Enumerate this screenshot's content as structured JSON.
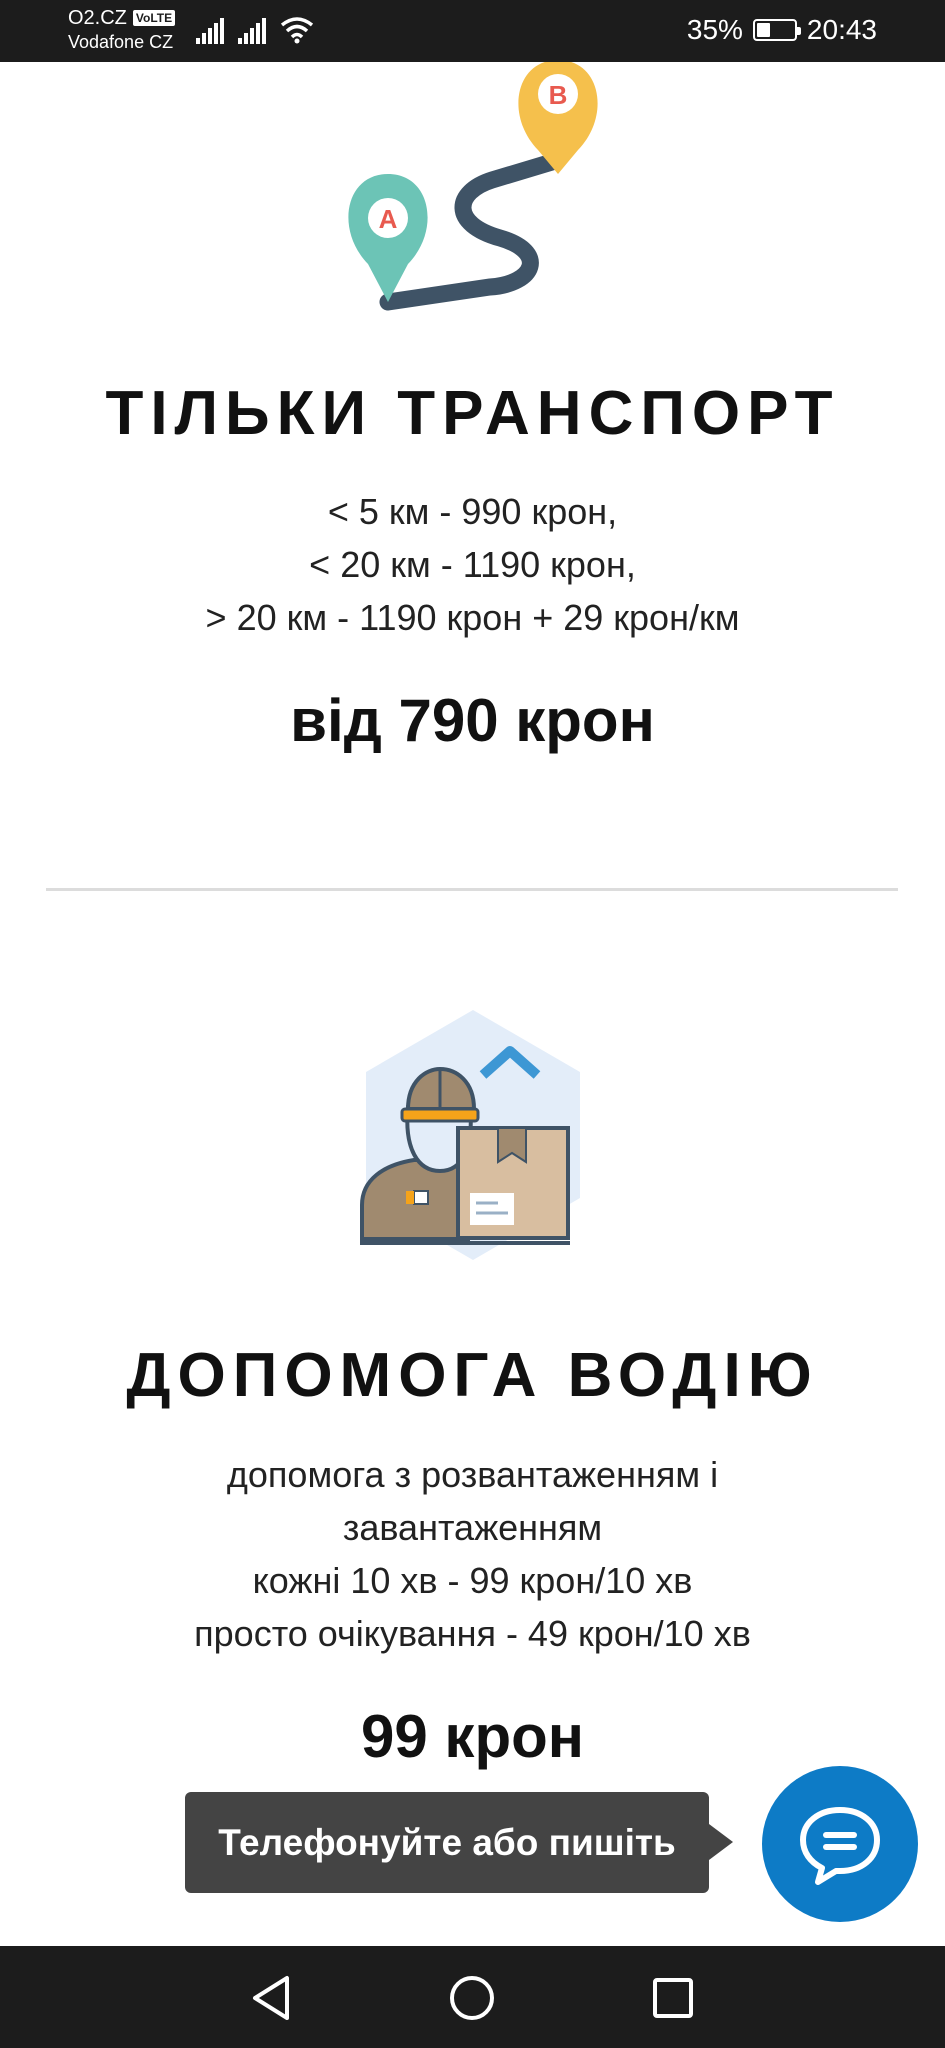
{
  "status_bar": {
    "carrier_primary": "O2.CZ",
    "volte_label": "VoLTE",
    "carrier_secondary": "Vodafone CZ",
    "battery_percent_text": "35%",
    "battery_level": 0.35,
    "time": "20:43"
  },
  "services": [
    {
      "title": "ТІЛЬКИ ТРАНСПОРТ",
      "desc_lines": [
        "< 5 км - 990 крон,",
        "< 20 км - 1190 крон,",
        "> 20 км - 1190 крон + 29 крон/км"
      ],
      "price": "від 790 крон",
      "illustration_labels": [
        "A",
        "B"
      ]
    },
    {
      "title": "ДОПОМОГА ВОДІЮ",
      "desc_lines": [
        "допомога з розвантаженням і",
        "завантаженням",
        "кожні 10 хв - 99 крон/10 хв",
        "просто очікування - 49 крон/10 хв"
      ],
      "price": "99 крон"
    }
  ],
  "chat": {
    "tooltip": "Телефонуйте або пишіть",
    "icon": "chat-bubble-icon"
  },
  "nav_bar": {
    "icons": [
      "back-icon",
      "home-icon",
      "recent-apps-icon"
    ]
  },
  "colors": {
    "status_bar_bg": "#1c1c1c",
    "chat_accent": "#0d7bc6",
    "tooltip_bg": "#444444",
    "pin_a": "#6cc4b6",
    "pin_b": "#f5c04c",
    "route": "#3f5366"
  }
}
